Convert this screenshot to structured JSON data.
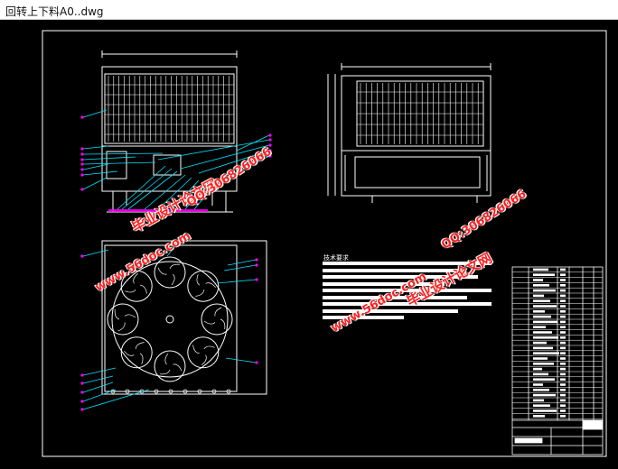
{
  "window": {
    "title": "回转上下料A0..dwg"
  },
  "drawing": {
    "tech_requirements_title": "技术要求"
  },
  "watermarks": {
    "brand": "毕业设计论文网",
    "url": "www.56doc.com",
    "qq": "QQ:306826066"
  },
  "colors": {
    "background": "#000000",
    "linework": "#ffffff",
    "leaders": "#00e5ff",
    "balloons": "#ff00ff",
    "watermark": "#ff1f1f"
  }
}
